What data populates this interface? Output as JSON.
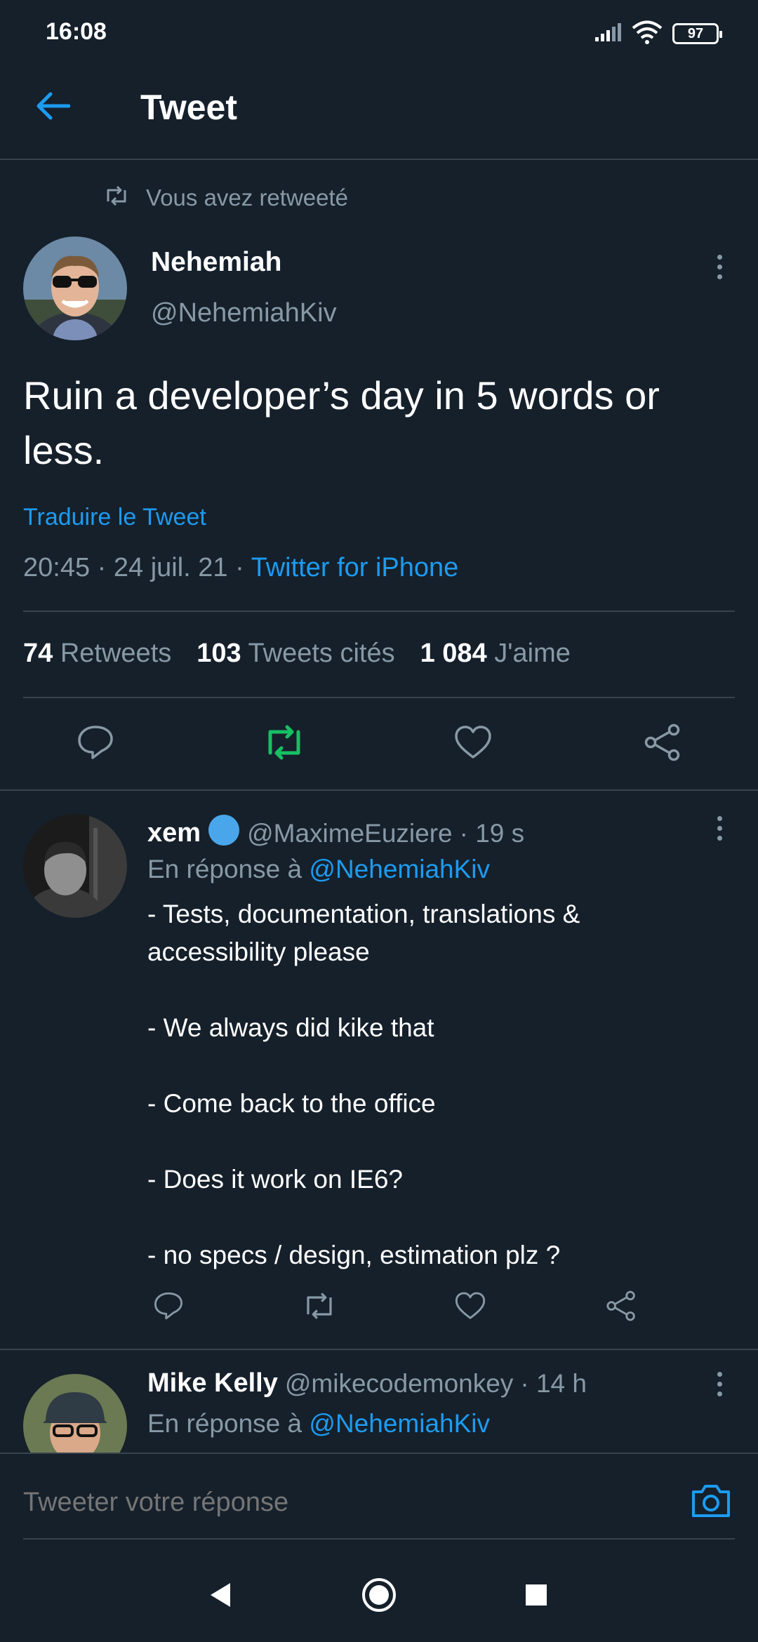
{
  "status_bar": {
    "time": "16:08",
    "battery": "97",
    "icons": [
      "signal-icon",
      "wifi-icon",
      "battery-icon"
    ]
  },
  "header": {
    "title": "Tweet",
    "back_icon": "arrow-left-icon"
  },
  "main_tweet": {
    "retweet_notice": "Vous avez retweeté",
    "author_name": "Nehemiah",
    "author_handle": "@NehemiahKiv",
    "text": "Ruin a developer’s day in 5 words or less.",
    "translate_label": "Traduire le Tweet",
    "timestamp": "20:45 · 24 juil. 21 · ",
    "source": "Twitter for iPhone",
    "stats": [
      {
        "value": "74",
        "label": "Retweets"
      },
      {
        "value": "103",
        "label": "Tweets cités"
      },
      {
        "value": "1 084",
        "label": "J'aime"
      }
    ],
    "retweeted": true
  },
  "replies": [
    {
      "name": "xem",
      "verified": true,
      "handle": "@MaximeEuziere",
      "time": "· 19 s",
      "reply_prefix": "En réponse à",
      "reply_to": "@NehemiahKiv",
      "lines": [
        "- Tests, documentation, translations &",
        "accessibility please",
        "",
        "- We always did kike that",
        "",
        "- Come back to the office",
        "",
        "- Does it work on IE6?",
        "",
        "- no specs / design, estimation plz ?"
      ]
    },
    {
      "name": "Mike Kelly",
      "verified": false,
      "handle": "@mikecodemonkey",
      "time": "· 14 h",
      "reply_prefix": "En réponse à",
      "reply_to": "@NehemiahKiv"
    }
  ],
  "composer": {
    "placeholder": "Tweeter votre réponse"
  },
  "colors": {
    "background": "#15202b",
    "accent": "#1d9bf0",
    "retweet_green": "#17bf63",
    "muted": "#8899a6",
    "divider": "#38444d"
  }
}
